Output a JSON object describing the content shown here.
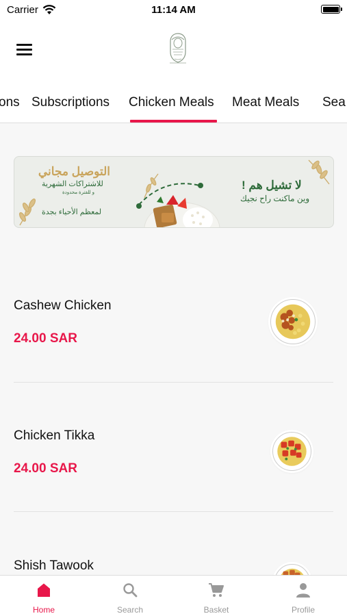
{
  "status_bar": {
    "carrier": "Carrier",
    "time": "11:14 AM"
  },
  "header": {
    "logo_icon": "crest-logo-icon",
    "menu_icon": "hamburger-menu-icon"
  },
  "tabs": [
    {
      "label": "ons",
      "active": false
    },
    {
      "label": "Subscriptions",
      "active": false
    },
    {
      "label": "Chicken Meals",
      "active": true
    },
    {
      "label": "Meat Meals",
      "active": false
    },
    {
      "label": "Sea",
      "active": false
    }
  ],
  "banner": {
    "headline_left": "التوصيل مجاني",
    "subline_left": "للاشتراكات الشهرية",
    "tiny_left": "و للفترة محدودة",
    "footer_left": "لمعظم الأحياء بجدة",
    "headline_right": "لا تشيل هم !",
    "subline_right": "وين ماكنت راح نجيك"
  },
  "items": [
    {
      "name": "Cashew Chicken",
      "price": "24.00 SAR"
    },
    {
      "name": "Chicken Tikka",
      "price": "24.00 SAR"
    },
    {
      "name": "Shish Tawook",
      "price": ""
    }
  ],
  "bottom_nav": [
    {
      "label": "Home",
      "icon": "home-icon",
      "active": true
    },
    {
      "label": "Search",
      "icon": "search-icon",
      "active": false
    },
    {
      "label": "Basket",
      "icon": "cart-icon",
      "active": false
    },
    {
      "label": "Profile",
      "icon": "person-icon",
      "active": false
    }
  ],
  "colors": {
    "accent": "#e8174a",
    "banner_green": "#2e6b3a",
    "banner_gold": "#c9a45c"
  }
}
